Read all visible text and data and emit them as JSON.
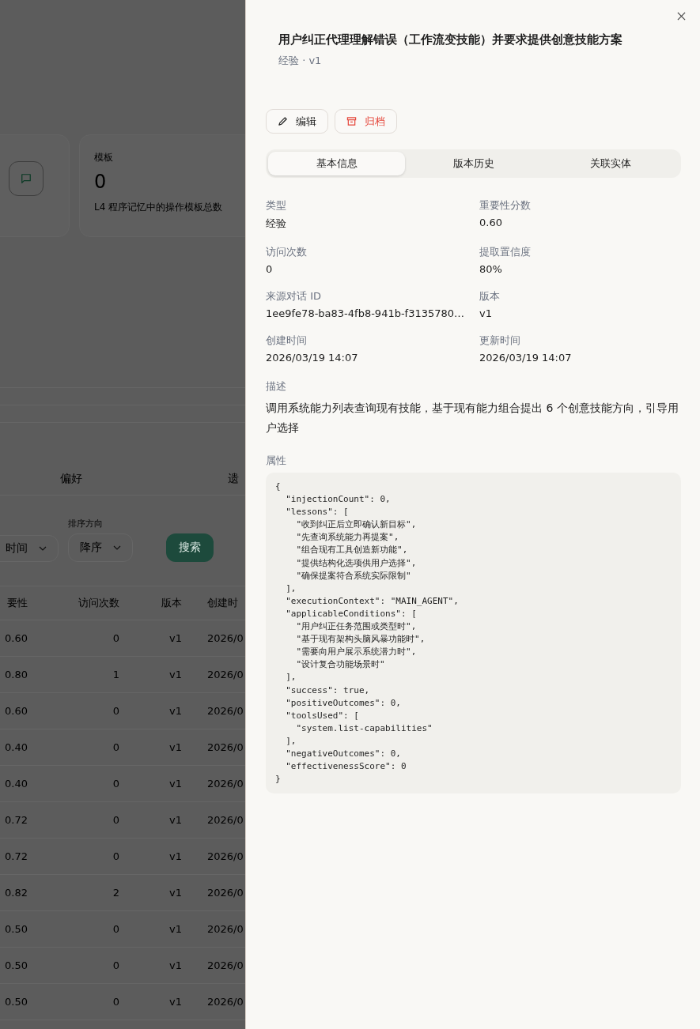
{
  "background": {
    "stat_cards": [
      {
        "kind": "icon"
      },
      {
        "kind": "text",
        "label": "模板",
        "value": "0",
        "description": "L4 程序记忆中的操作模板总数"
      }
    ],
    "tabs": [
      "偏好",
      "遗"
    ],
    "filters": [
      {
        "value": "时间"
      },
      {
        "label": "排序方向",
        "value": "降序"
      }
    ],
    "search_button": "搜索",
    "table": {
      "columns": [
        "要性",
        "访问次数",
        "版本",
        "创建时"
      ],
      "rows": [
        [
          "0.60",
          "0",
          "v1",
          "2026/0"
        ],
        [
          "0.80",
          "1",
          "v1",
          "2026/0"
        ],
        [
          "0.60",
          "0",
          "v1",
          "2026/0"
        ],
        [
          "0.40",
          "0",
          "v1",
          "2026/0"
        ],
        [
          "0.40",
          "0",
          "v1",
          "2026/0"
        ],
        [
          "0.72",
          "0",
          "v1",
          "2026/0"
        ],
        [
          "0.72",
          "0",
          "v1",
          "2026/0"
        ],
        [
          "0.82",
          "2",
          "v1",
          "2026/0"
        ],
        [
          "0.50",
          "0",
          "v1",
          "2026/0"
        ],
        [
          "0.50",
          "0",
          "v1",
          "2026/0"
        ],
        [
          "0.50",
          "0",
          "v1",
          "2026/0"
        ]
      ]
    }
  },
  "drawer": {
    "title": "用户纠正代理理解错误（工作流变技能）并要求提供创意技能方案",
    "subtitle": "经验 · v1",
    "actions": [
      {
        "label": "编辑",
        "kind": "edit"
      },
      {
        "label": "归档",
        "kind": "archive"
      }
    ],
    "tabs": [
      {
        "label": "基本信息",
        "selected": true
      },
      {
        "label": "版本历史",
        "selected": false
      },
      {
        "label": "关联实体",
        "selected": false
      }
    ],
    "fields": [
      {
        "label": "类型",
        "value": "经验"
      },
      {
        "label": "重要性分数",
        "value": "0.60"
      },
      {
        "label": "访问次数",
        "value": "0"
      },
      {
        "label": "提取置信度",
        "value": "80%"
      },
      {
        "label": "来源对话 ID",
        "value": "1ee9fe78-ba83-4fb8-941b-f3135780…"
      },
      {
        "label": "版本",
        "value": "v1"
      },
      {
        "label": "创建时间",
        "value": "2026/03/19 14:07"
      },
      {
        "label": "更新时间",
        "value": "2026/03/19 14:07"
      }
    ],
    "description_label": "描述",
    "description": "调用系统能力列表查询现有技能，基于现有能力组合提出 6 个创意技能方向，引导用户选择",
    "attributes_label": "属性",
    "attributes": "{\n  \"injectionCount\": 0,\n  \"lessons\": [\n    \"收到纠正后立即确认新目标\",\n    \"先查询系统能力再提案\",\n    \"组合现有工具创造新功能\",\n    \"提供结构化选项供用户选择\",\n    \"确保提案符合系统实际限制\"\n  ],\n  \"executionContext\": \"MAIN_AGENT\",\n  \"applicableConditions\": [\n    \"用户纠正任务范围或类型时\",\n    \"基于现有架构头脑风暴功能时\",\n    \"需要向用户展示系统潜力时\",\n    \"设计复合功能场景时\"\n  ],\n  \"success\": true,\n  \"positiveOutcomes\": 0,\n  \"toolsUsed\": [\n    \"system.list-capabilities\"\n  ],\n  \"negativeOutcomes\": 0,\n  \"effectivenessScore\": 0\n}"
  }
}
